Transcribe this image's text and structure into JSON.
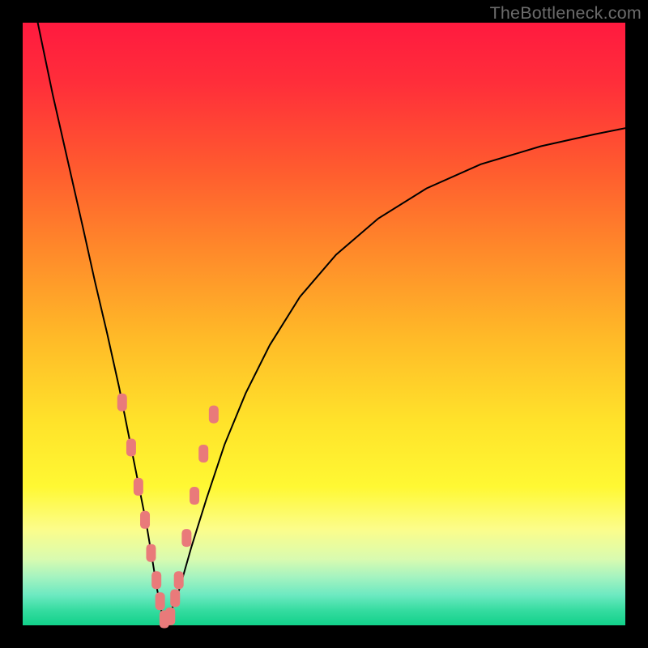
{
  "watermark": "TheBottleneck.com",
  "colors": {
    "curve_stroke": "#000000",
    "marker_fill": "#e97a7a",
    "frame_bg_top": "#ff1a3f",
    "frame_bg_bottom": "#12d18a",
    "page_bg": "#000000"
  },
  "chart_data": {
    "type": "line",
    "title": "",
    "xlabel": "",
    "ylabel": "",
    "xlim": [
      0,
      100
    ],
    "ylim": [
      0,
      100
    ],
    "grid": false,
    "legend": false,
    "series": [
      {
        "name": "left-branch",
        "x": [
          2.5,
          5,
          7.5,
          10,
          12,
          14,
          16,
          17.5,
          19,
          20.5,
          21.5,
          22.3,
          23.0,
          23.5
        ],
        "y": [
          100,
          88,
          77,
          66,
          57,
          48.5,
          39.5,
          32,
          24.5,
          17,
          11,
          6,
          2.5,
          0.5
        ]
      },
      {
        "name": "right-branch",
        "x": [
          23.5,
          24.5,
          26,
          28,
          30.5,
          33.5,
          37,
          41,
          46,
          52,
          59,
          67,
          76,
          86,
          95,
          100
        ],
        "y": [
          0.5,
          2.0,
          6,
          13,
          21,
          30,
          38.5,
          46.5,
          54.5,
          61.5,
          67.5,
          72.5,
          76.5,
          79.5,
          81.5,
          82.5
        ]
      }
    ],
    "markers": {
      "name": "highlight-points",
      "shape": "rounded-rect",
      "x": [
        16.5,
        18.0,
        19.2,
        20.3,
        21.3,
        22.2,
        22.8,
        23.5,
        24.5,
        25.3,
        25.9,
        27.2,
        28.5,
        30.0,
        31.7
      ],
      "y": [
        37.0,
        29.5,
        23.0,
        17.5,
        12.0,
        7.5,
        4.0,
        1.0,
        1.5,
        4.5,
        7.5,
        14.5,
        21.5,
        28.5,
        35.0
      ]
    }
  }
}
